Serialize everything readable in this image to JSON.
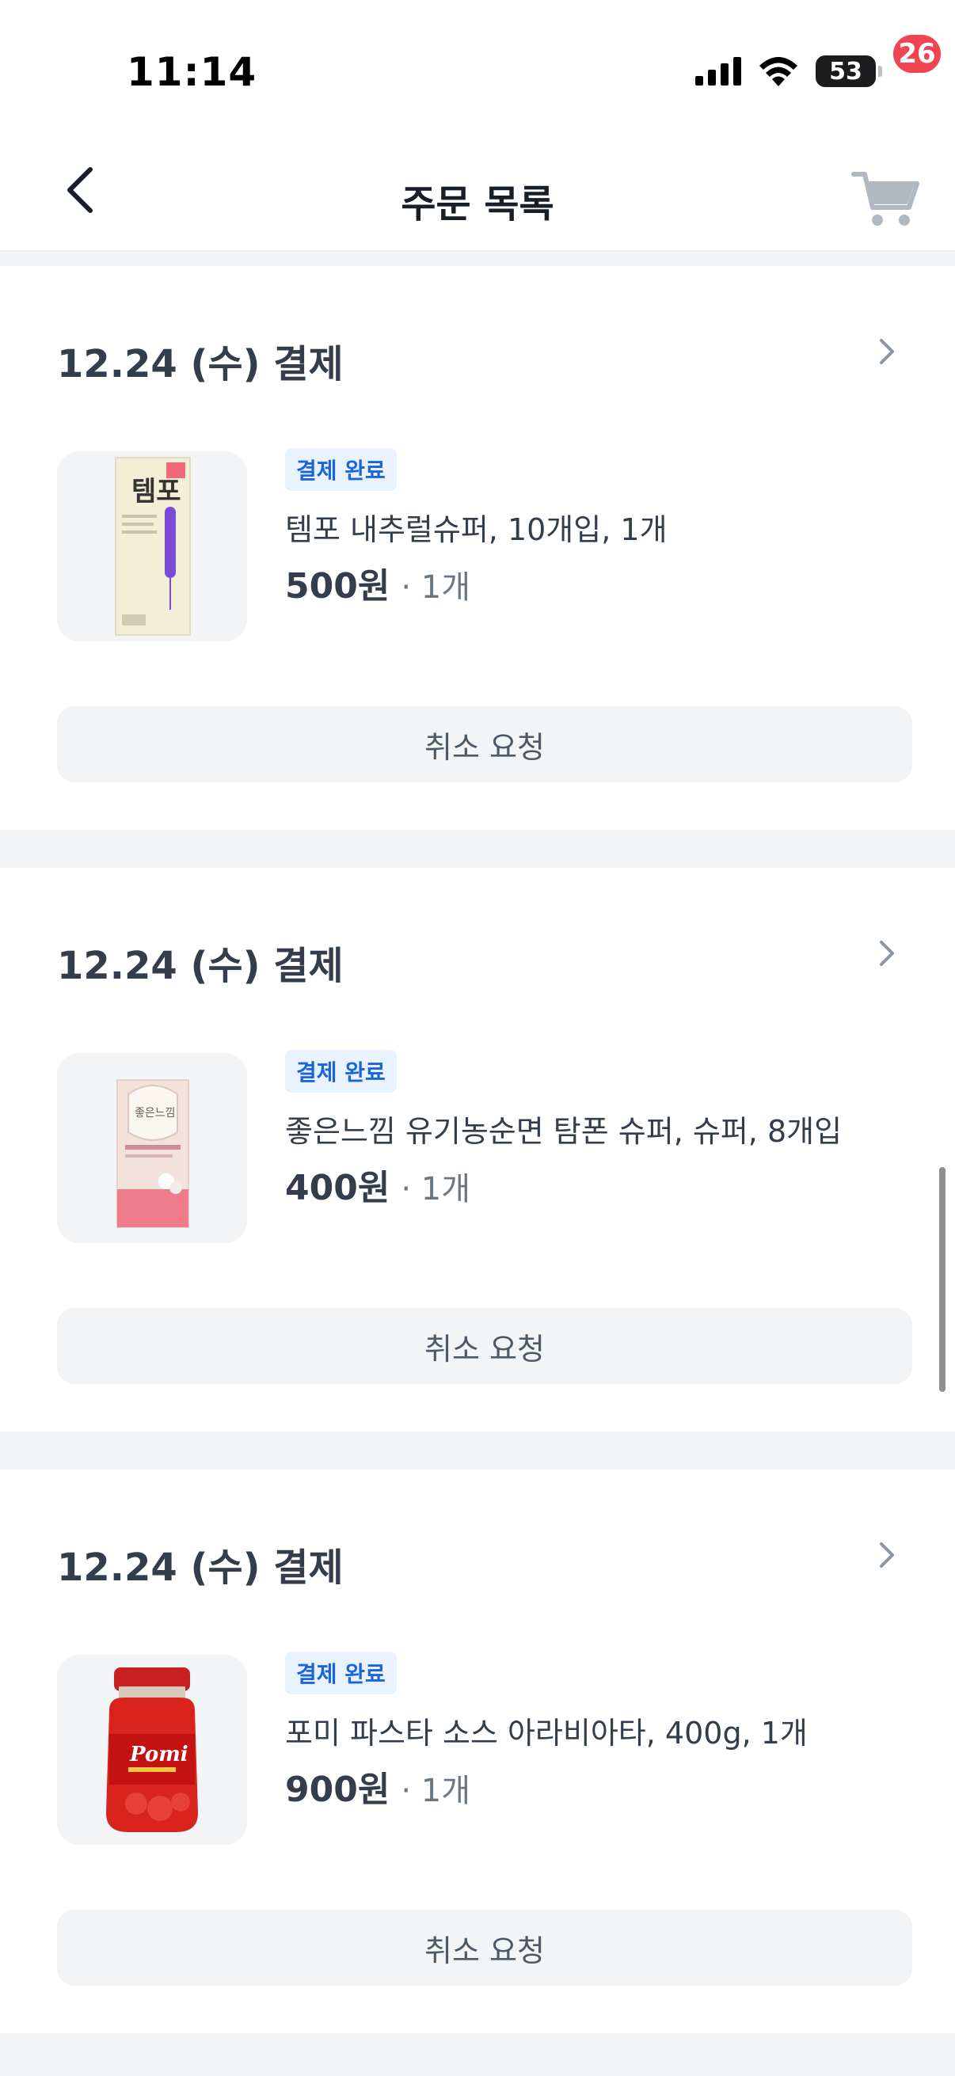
{
  "status_bar": {
    "time": "11:14",
    "battery": "53",
    "signal_icon": "cellular-signal-icon",
    "wifi_icon": "wifi-icon"
  },
  "header": {
    "title": "주문 목록",
    "back_icon": "chevron-left-icon",
    "cart_icon": "cart-icon",
    "cart_count": "26"
  },
  "orders": [
    {
      "date": "12.24 (수) 결제",
      "status": "결제 완료",
      "product_name": "템포 내추럴슈퍼, 10개입, 1개",
      "price": "500원",
      "quantity": "· 1개",
      "image_text": "템포",
      "cancel_label": "취소 요청"
    },
    {
      "date": "12.24 (수) 결제",
      "status": "결제 완료",
      "product_name": "좋은느낌 유기농순면 탐폰 슈퍼, 슈퍼, 8개입",
      "price": "400원",
      "quantity": "· 1개",
      "image_text": "좋은느낌",
      "cancel_label": "취소 요청"
    },
    {
      "date": "12.24 (수) 결제",
      "status": "결제 완료",
      "product_name": "포미 파스타 소스 아라비아타, 400g, 1개",
      "price": "900원",
      "quantity": "· 1개",
      "image_text": "Pomi",
      "cancel_label": "취소 요청"
    }
  ],
  "colors": {
    "accent_blue": "#1b64da",
    "badge_red": "#f04452",
    "text_dark": "#333d4b",
    "divider": "#f2f3f5"
  }
}
